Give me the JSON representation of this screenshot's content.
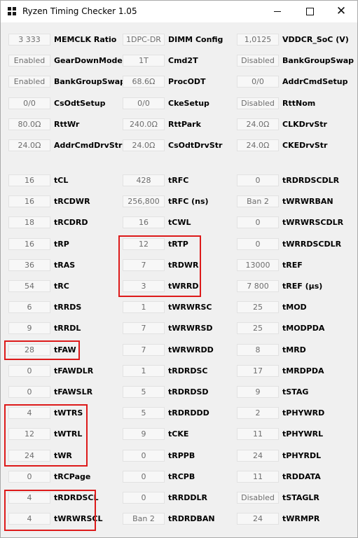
{
  "window": {
    "title": "Ryzen Timing Checker 1.05",
    "icons": {
      "app": "windows-logo-icon",
      "minimize": "minimize-icon",
      "maximize": "maximize-icon",
      "close": "close-icon"
    },
    "close_glyph": "✕"
  },
  "config_rows": [
    [
      {
        "value": "3 333",
        "label": "MEMCLK Ratio"
      },
      {
        "value": "1DPC-DR",
        "label": "DIMM Config"
      },
      {
        "value": "1,0125",
        "label": "VDDCR_SoC (V)"
      }
    ],
    [
      {
        "value": "Enabled",
        "label": "GearDownMode"
      },
      {
        "value": "1T",
        "label": "Cmd2T"
      },
      {
        "value": "Disabled",
        "label": "BankGroupSwap"
      }
    ],
    [
      {
        "value": "Enabled",
        "label": "BankGroupSwapAlt"
      },
      {
        "value": "68.6Ω",
        "label": "ProcODT"
      },
      {
        "value": "0/0",
        "label": "AddrCmdSetup"
      }
    ],
    [
      {
        "value": "0/0",
        "label": "CsOdtSetup"
      },
      {
        "value": "0/0",
        "label": "CkeSetup"
      },
      {
        "value": "Disabled",
        "label": "RttNom"
      }
    ],
    [
      {
        "value": "80.0Ω",
        "label": "RttWr"
      },
      {
        "value": "240.0Ω",
        "label": "RttPark"
      },
      {
        "value": "24.0Ω",
        "label": "CLKDrvStr"
      }
    ],
    [
      {
        "value": "24.0Ω",
        "label": "AddrCmdDrvStr"
      },
      {
        "value": "24.0Ω",
        "label": "CsOdtDrvStr"
      },
      {
        "value": "24.0Ω",
        "label": "CKEDrvStr"
      }
    ]
  ],
  "timing_rows": [
    [
      {
        "value": "16",
        "label": "tCL"
      },
      {
        "value": "428",
        "label": "tRFC"
      },
      {
        "value": "0",
        "label": "tRDRDSCDLR"
      }
    ],
    [
      {
        "value": "16",
        "label": "tRCDWR"
      },
      {
        "value": "256,800",
        "label": "tRFC (ns)"
      },
      {
        "value": "Ban 2",
        "label": "tWRWRBAN"
      }
    ],
    [
      {
        "value": "18",
        "label": "tRCDRD"
      },
      {
        "value": "16",
        "label": "tCWL"
      },
      {
        "value": "0",
        "label": "tWRWRSCDLR"
      }
    ],
    [
      {
        "value": "16",
        "label": "tRP"
      },
      {
        "value": "12",
        "label": "tRTP"
      },
      {
        "value": "0",
        "label": "tWRRDSCDLR"
      }
    ],
    [
      {
        "value": "36",
        "label": "tRAS"
      },
      {
        "value": "7",
        "label": "tRDWR"
      },
      {
        "value": "13000",
        "label": "tREF"
      }
    ],
    [
      {
        "value": "54",
        "label": "tRC"
      },
      {
        "value": "3",
        "label": "tWRRD"
      },
      {
        "value": "7 800",
        "label": "tREF (µs)"
      }
    ],
    [
      {
        "value": "6",
        "label": "tRRDS"
      },
      {
        "value": "1",
        "label": "tWRWRSC"
      },
      {
        "value": "25",
        "label": "tMOD"
      }
    ],
    [
      {
        "value": "9",
        "label": "tRRDL"
      },
      {
        "value": "7",
        "label": "tWRWRSD"
      },
      {
        "value": "25",
        "label": "tMODPDA"
      }
    ],
    [
      {
        "value": "28",
        "label": "tFAW"
      },
      {
        "value": "7",
        "label": "tWRWRDD"
      },
      {
        "value": "8",
        "label": "tMRD"
      }
    ],
    [
      {
        "value": "0",
        "label": "tFAWDLR"
      },
      {
        "value": "1",
        "label": "tRDRDSC"
      },
      {
        "value": "17",
        "label": "tMRDPDA"
      }
    ],
    [
      {
        "value": "0",
        "label": "tFAWSLR"
      },
      {
        "value": "5",
        "label": "tRDRDSD"
      },
      {
        "value": "9",
        "label": "tSTAG"
      }
    ],
    [
      {
        "value": "4",
        "label": "tWTRS"
      },
      {
        "value": "5",
        "label": "tRDRDDD"
      },
      {
        "value": "2",
        "label": "tPHYWRD"
      }
    ],
    [
      {
        "value": "12",
        "label": "tWTRL"
      },
      {
        "value": "9",
        "label": "tCKE"
      },
      {
        "value": "11",
        "label": "tPHYWRL"
      }
    ],
    [
      {
        "value": "24",
        "label": "tWR"
      },
      {
        "value": "0",
        "label": "tRPPB"
      },
      {
        "value": "24",
        "label": "tPHYRDL"
      }
    ],
    [
      {
        "value": "0",
        "label": "tRCPage"
      },
      {
        "value": "0",
        "label": "tRCPB"
      },
      {
        "value": "11",
        "label": "tRDDATA"
      }
    ],
    [
      {
        "value": "4",
        "label": "tRDRDSCL"
      },
      {
        "value": "0",
        "label": "tRRDDLR"
      },
      {
        "value": "Disabled",
        "label": "tSTAGLR"
      }
    ],
    [
      {
        "value": "4",
        "label": "tWRWRSCL"
      },
      {
        "value": "Ban 2",
        "label": "tRDRDBAN"
      },
      {
        "value": "24",
        "label": "tWRMPR"
      }
    ]
  ],
  "highlight_color": "#dd1a1a"
}
